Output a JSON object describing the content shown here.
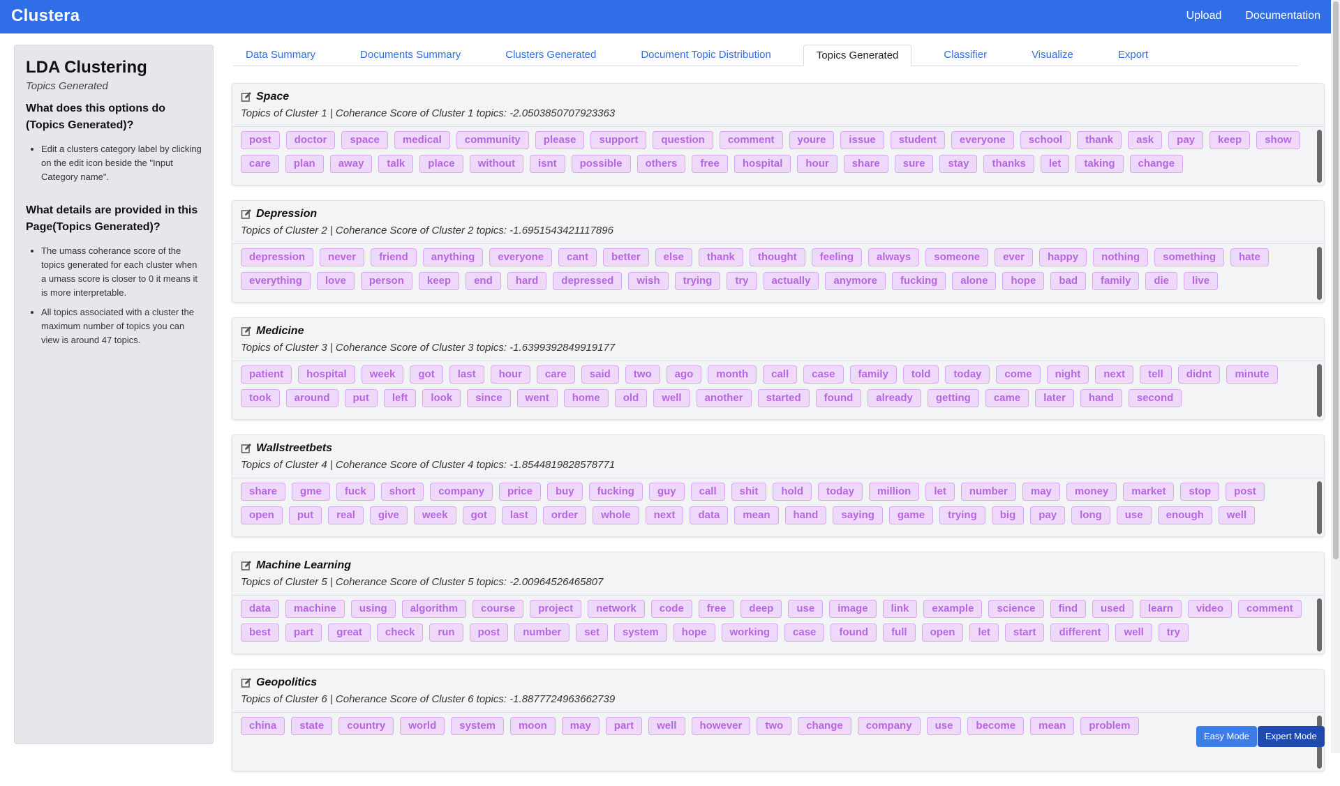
{
  "app": {
    "brand": "Clustera",
    "nav": [
      "Upload",
      "Documentation"
    ]
  },
  "sidebar": {
    "title": "LDA Clustering",
    "subtitle": "Topics Generated",
    "sections": [
      {
        "question": "What does this options do (Topics Generated)?",
        "bullets": [
          "Edit a clusters category label by clicking on the edit icon beside the \"Input Category name\"."
        ]
      },
      {
        "question": "What details are provided in this Page(Topics Generated)?",
        "bullets": [
          "The umass coherance score of the topics generated for each cluster when a umass score is closer to 0 it means it is more interpretable.",
          "All topics associated with a cluster the maximum number of topics you can view is around 47 topics."
        ]
      }
    ]
  },
  "tabs": [
    {
      "label": "Data Summary",
      "active": false
    },
    {
      "label": "Documents Summary",
      "active": false
    },
    {
      "label": "Clusters Generated",
      "active": false
    },
    {
      "label": "Document Topic Distribution",
      "active": false
    },
    {
      "label": "Topics Generated",
      "active": true
    },
    {
      "label": "Classifier",
      "active": false
    },
    {
      "label": "Visualize",
      "active": false
    },
    {
      "label": "Export",
      "active": false
    }
  ],
  "colors": {
    "navbar": "#2f6ee6",
    "chip_bg": "#efd9fb",
    "chip_text": "#b667e0",
    "easy_mode": "#3d7de8",
    "expert_mode": "#1f4bb0"
  },
  "clusters": [
    {
      "name": "Space",
      "subtitle": "Topics of Cluster 1  |  Coherance Score of Cluster 1 topics: -2.0503850707923363",
      "topics": [
        "post",
        "doctor",
        "space",
        "medical",
        "community",
        "please",
        "support",
        "question",
        "comment",
        "youre",
        "issue",
        "student",
        "everyone",
        "school",
        "thank",
        "ask",
        "pay",
        "keep",
        "show",
        "care",
        "plan",
        "away",
        "talk",
        "place",
        "without",
        "isnt",
        "possible",
        "others",
        "free",
        "hospital",
        "hour",
        "share",
        "sure",
        "stay",
        "thanks",
        "let",
        "taking",
        "change"
      ]
    },
    {
      "name": "Depression",
      "subtitle": "Topics of Cluster 2  |  Coherance Score of Cluster 2 topics: -1.6951543421117896",
      "topics": [
        "depression",
        "never",
        "friend",
        "anything",
        "everyone",
        "cant",
        "better",
        "else",
        "thank",
        "thought",
        "feeling",
        "always",
        "someone",
        "ever",
        "happy",
        "nothing",
        "something",
        "hate",
        "everything",
        "love",
        "person",
        "keep",
        "end",
        "hard",
        "depressed",
        "wish",
        "trying",
        "try",
        "actually",
        "anymore",
        "fucking",
        "alone",
        "hope",
        "bad",
        "family",
        "die",
        "live"
      ]
    },
    {
      "name": "Medicine",
      "subtitle": "Topics of Cluster 3  |  Coherance Score of Cluster 3 topics: -1.6399392849919177",
      "topics": [
        "patient",
        "hospital",
        "week",
        "got",
        "last",
        "hour",
        "care",
        "said",
        "two",
        "ago",
        "month",
        "call",
        "case",
        "family",
        "told",
        "today",
        "come",
        "night",
        "next",
        "tell",
        "didnt",
        "minute",
        "took",
        "around",
        "put",
        "left",
        "look",
        "since",
        "went",
        "home",
        "old",
        "well",
        "another",
        "started",
        "found",
        "already",
        "getting",
        "came",
        "later",
        "hand",
        "second"
      ]
    },
    {
      "name": "Wallstreetbets",
      "subtitle": "Topics of Cluster 4  |  Coherance Score of Cluster 4 topics: -1.8544819828578771",
      "topics": [
        "share",
        "gme",
        "fuck",
        "short",
        "company",
        "price",
        "buy",
        "fucking",
        "guy",
        "call",
        "shit",
        "hold",
        "today",
        "million",
        "let",
        "number",
        "may",
        "money",
        "market",
        "stop",
        "post",
        "open",
        "put",
        "real",
        "give",
        "week",
        "got",
        "last",
        "order",
        "whole",
        "next",
        "data",
        "mean",
        "hand",
        "saying",
        "game",
        "trying",
        "big",
        "pay",
        "long",
        "use",
        "enough",
        "well"
      ]
    },
    {
      "name": "Machine Learning",
      "subtitle": "Topics of Cluster 5  |  Coherance Score of Cluster 5 topics: -2.00964526465807",
      "topics": [
        "data",
        "machine",
        "using",
        "algorithm",
        "course",
        "project",
        "network",
        "code",
        "free",
        "deep",
        "use",
        "image",
        "link",
        "example",
        "science",
        "find",
        "used",
        "learn",
        "video",
        "comment",
        "best",
        "part",
        "great",
        "check",
        "run",
        "post",
        "number",
        "set",
        "system",
        "hope",
        "working",
        "case",
        "found",
        "full",
        "open",
        "let",
        "start",
        "different",
        "well",
        "try"
      ]
    },
    {
      "name": "Geopolitics",
      "subtitle": "Topics of Cluster 6  |  Coherance Score of Cluster 6 topics: -1.8877724963662739",
      "topics": [
        "china",
        "state",
        "country",
        "world",
        "system",
        "moon",
        "may",
        "part",
        "well",
        "however",
        "two",
        "change",
        "company",
        "use",
        "become",
        "mean",
        "problem"
      ]
    }
  ],
  "modes": {
    "easy": "Easy Mode",
    "expert": "Expert Mode"
  }
}
